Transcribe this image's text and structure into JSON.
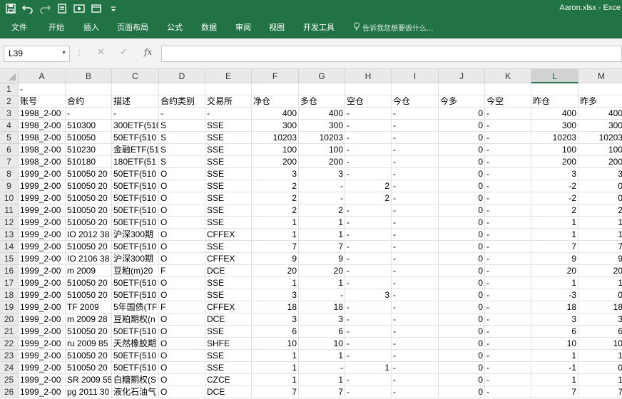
{
  "title": "Aaron.xlsx - Exce",
  "ribbon_tabs": [
    "文件",
    "开始",
    "插入",
    "页面布局",
    "公式",
    "数据",
    "审阅",
    "视图",
    "开发工具"
  ],
  "tell_me": "告诉我您想要做什么...",
  "name_box": "L39",
  "fx_label": "fx",
  "columns": [
    "A",
    "B",
    "C",
    "D",
    "E",
    "F",
    "G",
    "H",
    "I",
    "J",
    "K",
    "L",
    "M"
  ],
  "selected_column": "L",
  "row_numbers": [
    "1",
    "2",
    "3",
    "4",
    "5",
    "6",
    "7",
    "8",
    "9",
    "10",
    "11",
    "12",
    "13",
    "14",
    "15",
    "16",
    "17",
    "18",
    "19",
    "20",
    "21",
    "22",
    "23",
    "24",
    "25",
    "26"
  ],
  "rows": [
    [
      "-",
      "",
      "",
      "",
      "",
      "",
      "",
      "",
      "",
      "",
      "",
      "",
      ""
    ],
    [
      "账号",
      "合约",
      "描述",
      "合约类别",
      "交易所",
      "净仓",
      "多仓",
      "空仓",
      "今仓",
      "今多",
      "今空",
      "昨仓",
      "昨多"
    ],
    [
      "1998_2-00",
      "-",
      "-",
      "-",
      "-",
      "400",
      "400",
      "-",
      "-",
      "0",
      "-",
      "400",
      "400"
    ],
    [
      "1998_2-00",
      "510300",
      "300ETF(510",
      "S",
      "SSE",
      "300",
      "300",
      "-",
      "-",
      "0",
      "-",
      "300",
      "300"
    ],
    [
      "1998_2-00",
      "510050",
      "50ETF(510",
      "S",
      "SSE",
      "10203",
      "10203",
      "-",
      "-",
      "0",
      "-",
      "10203",
      "10203"
    ],
    [
      "1998_2-00",
      "510230",
      "金融ETF(51",
      "S",
      "SSE",
      "100",
      "100",
      "-",
      "-",
      "0",
      "-",
      "100",
      "100"
    ],
    [
      "1998_2-00",
      "510180",
      "180ETF(51",
      "S",
      "SSE",
      "200",
      "200",
      "-",
      "-",
      "0",
      "-",
      "200",
      "200"
    ],
    [
      "1999_2-00",
      "510050 20",
      "50ETF(510",
      "O",
      "SSE",
      "3",
      "3",
      "-",
      "-",
      "0",
      "-",
      "3",
      "3"
    ],
    [
      "1999_2-00",
      "510050 20",
      "50ETF(510",
      "O",
      "SSE",
      "2",
      "-",
      "2",
      "-",
      "0",
      "-",
      "-2",
      "0"
    ],
    [
      "1999_2-00",
      "510050 20",
      "50ETF(510",
      "O",
      "SSE",
      "2",
      "-",
      "2",
      "-",
      "0",
      "-",
      "-2",
      "0"
    ],
    [
      "1999_2-00",
      "510050 20",
      "50ETF(510",
      "O",
      "SSE",
      "2",
      "2",
      "-",
      "-",
      "0",
      "-",
      "2",
      "2"
    ],
    [
      "1999_2-00",
      "510050 20",
      "50ETF(510",
      "O",
      "SSE",
      "1",
      "1",
      "-",
      "-",
      "0",
      "-",
      "1",
      "1"
    ],
    [
      "1999_2-00",
      "IO 2012 38",
      "沪深300期",
      "O",
      "CFFEX",
      "1",
      "1",
      "-",
      "-",
      "0",
      "-",
      "1",
      "1"
    ],
    [
      "1999_2-00",
      "510050 20",
      "50ETF(510",
      "O",
      "SSE",
      "7",
      "7",
      "-",
      "-",
      "0",
      "-",
      "7",
      "7"
    ],
    [
      "1999_2-00",
      "IO 2106 38",
      "沪深300期",
      "O",
      "CFFEX",
      "9",
      "9",
      "-",
      "-",
      "0",
      "-",
      "9",
      "9"
    ],
    [
      "1999_2-00",
      "m 2009",
      "豆粕(m)20",
      "F",
      "DCE",
      "20",
      "20",
      "-",
      "-",
      "0",
      "-",
      "20",
      "20"
    ],
    [
      "1999_2-00",
      "510050 20",
      "50ETF(510",
      "O",
      "SSE",
      "1",
      "1",
      "-",
      "-",
      "0",
      "-",
      "1",
      "1"
    ],
    [
      "1999_2-00",
      "510050 20",
      "50ETF(510",
      "O",
      "SSE",
      "3",
      "-",
      "3",
      "-",
      "0",
      "-",
      "-3",
      "0"
    ],
    [
      "1999_2-00",
      "TF 2009",
      "5年国债(TF",
      "F",
      "CFFEX",
      "18",
      "18",
      "-",
      "-",
      "0",
      "-",
      "18",
      "18"
    ],
    [
      "1999_2-00",
      "m 2009 28",
      "豆粕期权(n",
      "O",
      "DCE",
      "3",
      "3",
      "-",
      "-",
      "0",
      "-",
      "3",
      "3"
    ],
    [
      "1999_2-00",
      "510050 20",
      "50ETF(510",
      "O",
      "SSE",
      "6",
      "6",
      "-",
      "-",
      "0",
      "-",
      "6",
      "6"
    ],
    [
      "1999_2-00",
      "ru 2009 85",
      "天然橡胶期",
      "O",
      "SHFE",
      "10",
      "10",
      "-",
      "-",
      "0",
      "-",
      "10",
      "10"
    ],
    [
      "1999_2-00",
      "510050 20",
      "50ETF(510",
      "O",
      "SSE",
      "1",
      "1",
      "-",
      "-",
      "0",
      "-",
      "1",
      "1"
    ],
    [
      "1999_2-00",
      "510050 20",
      "50ETF(510",
      "O",
      "SSE",
      "1",
      "-",
      "1",
      "-",
      "0",
      "-",
      "-1",
      "0"
    ],
    [
      "1999_2-00",
      "SR 2009 55",
      "白糖期权(S",
      "O",
      "CZCE",
      "1",
      "1",
      "-",
      "-",
      "0",
      "-",
      "1",
      "1"
    ],
    [
      "1999_2-00",
      "pg 2011 30",
      "液化石油气",
      "O",
      "DCE",
      "7",
      "7",
      "-",
      "-",
      "0",
      "-",
      "7",
      "7"
    ]
  ]
}
